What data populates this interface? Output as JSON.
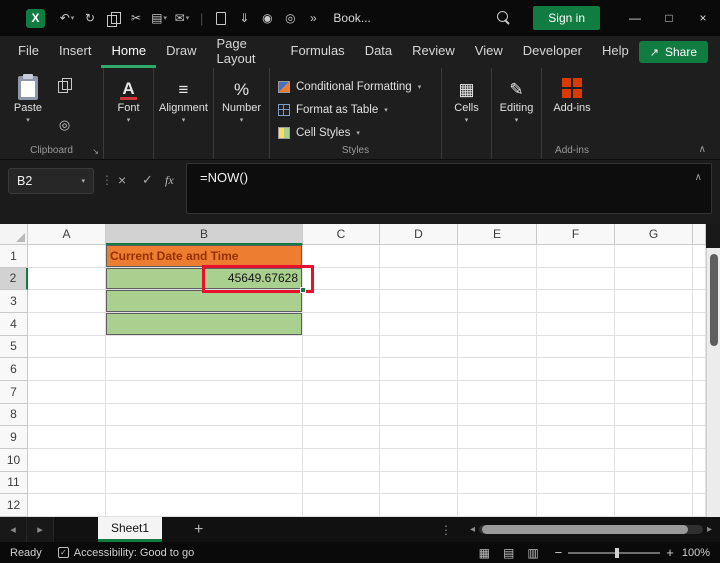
{
  "colors": {
    "accent_green": "#107C41",
    "header_fill": "#ED7D31",
    "header_text": "#963000",
    "value_fill": "#A9D08E",
    "highlight_red": "#E8112D",
    "addins_orange": "#D83B01"
  },
  "titlebar": {
    "logo": "X",
    "title": "Book...",
    "sign_in": "Sign in"
  },
  "menu": {
    "items": [
      "File",
      "Insert",
      "Home",
      "Draw",
      "Page Layout",
      "Formulas",
      "Data",
      "Review",
      "View",
      "Developer",
      "Help"
    ],
    "active": "Home",
    "share": "Share"
  },
  "ribbon": {
    "paste": "Paste",
    "clipboard_group": "Clipboard",
    "font": "Font",
    "alignment": "Alignment",
    "number": "Number",
    "conditional_formatting": "Conditional Formatting",
    "format_as_table": "Format as Table",
    "cell_styles": "Cell Styles",
    "styles_group": "Styles",
    "cells": "Cells",
    "editing": "Editing",
    "addins": "Add-ins",
    "addins_group": "Add-ins",
    "number_glyph": "%",
    "font_glyph": "A",
    "align_glyph": "≡",
    "cells_glyph": "▦",
    "edit_glyph": "✎"
  },
  "formula_bar": {
    "name_box": "B2",
    "formula": "=NOW()",
    "fx": "fx"
  },
  "grid": {
    "columns": [
      "A",
      "B",
      "C",
      "D",
      "E",
      "F",
      "G"
    ],
    "rows": [
      "1",
      "2",
      "3",
      "4",
      "5",
      "6",
      "7",
      "8",
      "9",
      "10",
      "11",
      "12"
    ],
    "active_column": "B",
    "active_row": "2",
    "active_cell": "B2",
    "cells": {
      "B1": {
        "text": "Current Date and Time",
        "class": "title-cell"
      },
      "B2": {
        "text": "45649.67628",
        "class": "value-cell"
      },
      "B3": {
        "class": "green-cell"
      },
      "B4": {
        "class": "green-cell"
      }
    }
  },
  "sheet_tabs": {
    "active": "Sheet1"
  },
  "status_bar": {
    "ready": "Ready",
    "accessibility": "Accessibility: Good to go",
    "zoom": "100%"
  },
  "icons": {
    "undo": "↶",
    "redo": "↻",
    "cut": "✂",
    "chart": "▤",
    "mail": "✉",
    "save": "⇓",
    "camera": "◉",
    "draw": "◎",
    "overflow": "»",
    "separator": "|",
    "caret": "▾",
    "launcher": "↘",
    "share": "↗",
    "dots": "⋮",
    "cancel": "×",
    "enter": "✓",
    "collapse": "∧",
    "minimize": "—",
    "maximize": "□",
    "close": "×",
    "prev": "◂",
    "next": "▸",
    "add": "+",
    "view_normal": "▦",
    "view_layout": "▤",
    "view_break": "▥",
    "zoom_out": "−",
    "zoom_in": "+",
    "acc_check": "✓"
  }
}
